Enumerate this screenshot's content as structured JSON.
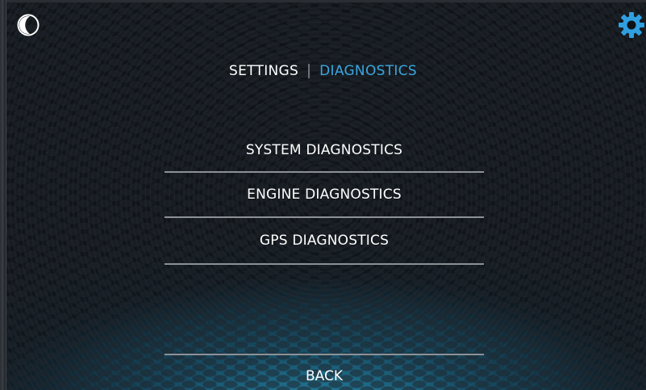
{
  "header": {
    "night_mode_icon": "moon-icon",
    "settings_icon": "gear-icon",
    "accent_color": "#3aa6e0"
  },
  "breadcrumb": {
    "parent": "SETTINGS",
    "current": "DIAGNOSTICS"
  },
  "menu": {
    "items": [
      {
        "label": "SYSTEM DIAGNOSTICS"
      },
      {
        "label": "ENGINE DIAGNOSTICS"
      },
      {
        "label": "GPS DIAGNOSTICS"
      }
    ]
  },
  "footer": {
    "back_label": "BACK"
  }
}
